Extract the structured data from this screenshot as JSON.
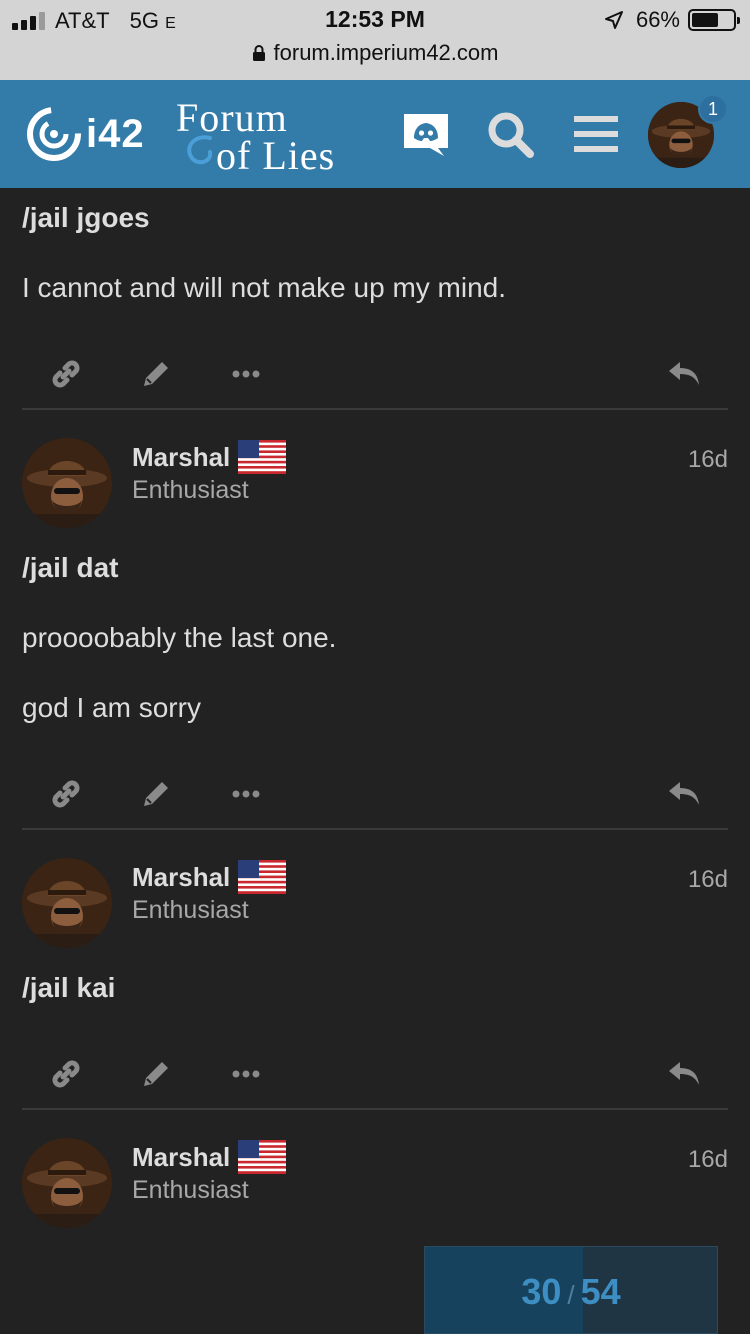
{
  "status_bar": {
    "carrier": "AT&T",
    "network": "5G",
    "network_suffix": "E",
    "time": "12:53 PM",
    "battery": "66%",
    "battery_level": 0.66,
    "url": "forum.imperium42.com"
  },
  "header": {
    "logo_text": "i42",
    "brand_line1": "Forum",
    "brand_line2": "of Lies",
    "notification_count": "1",
    "colors": {
      "header_bg": "#337ba8",
      "page_bg": "#222222"
    }
  },
  "posts": [
    {
      "command": "/jail jgoes",
      "paragraphs": [
        "I cannot and will not make up my mind."
      ]
    },
    {
      "username": "Marshal",
      "user_title": "Enthusiast",
      "date": "16d",
      "command": "/jail dat",
      "paragraphs": [
        "proooobably the last one.",
        "god I am sorry"
      ]
    },
    {
      "username": "Marshal",
      "user_title": "Enthusiast",
      "date": "16d",
      "command": "/jail kai",
      "paragraphs": []
    },
    {
      "username": "Marshal",
      "user_title": "Enthusiast",
      "date": "16d"
    }
  ],
  "progress": {
    "current": "30",
    "separator": "/",
    "total": "54",
    "fraction": 0.54
  }
}
